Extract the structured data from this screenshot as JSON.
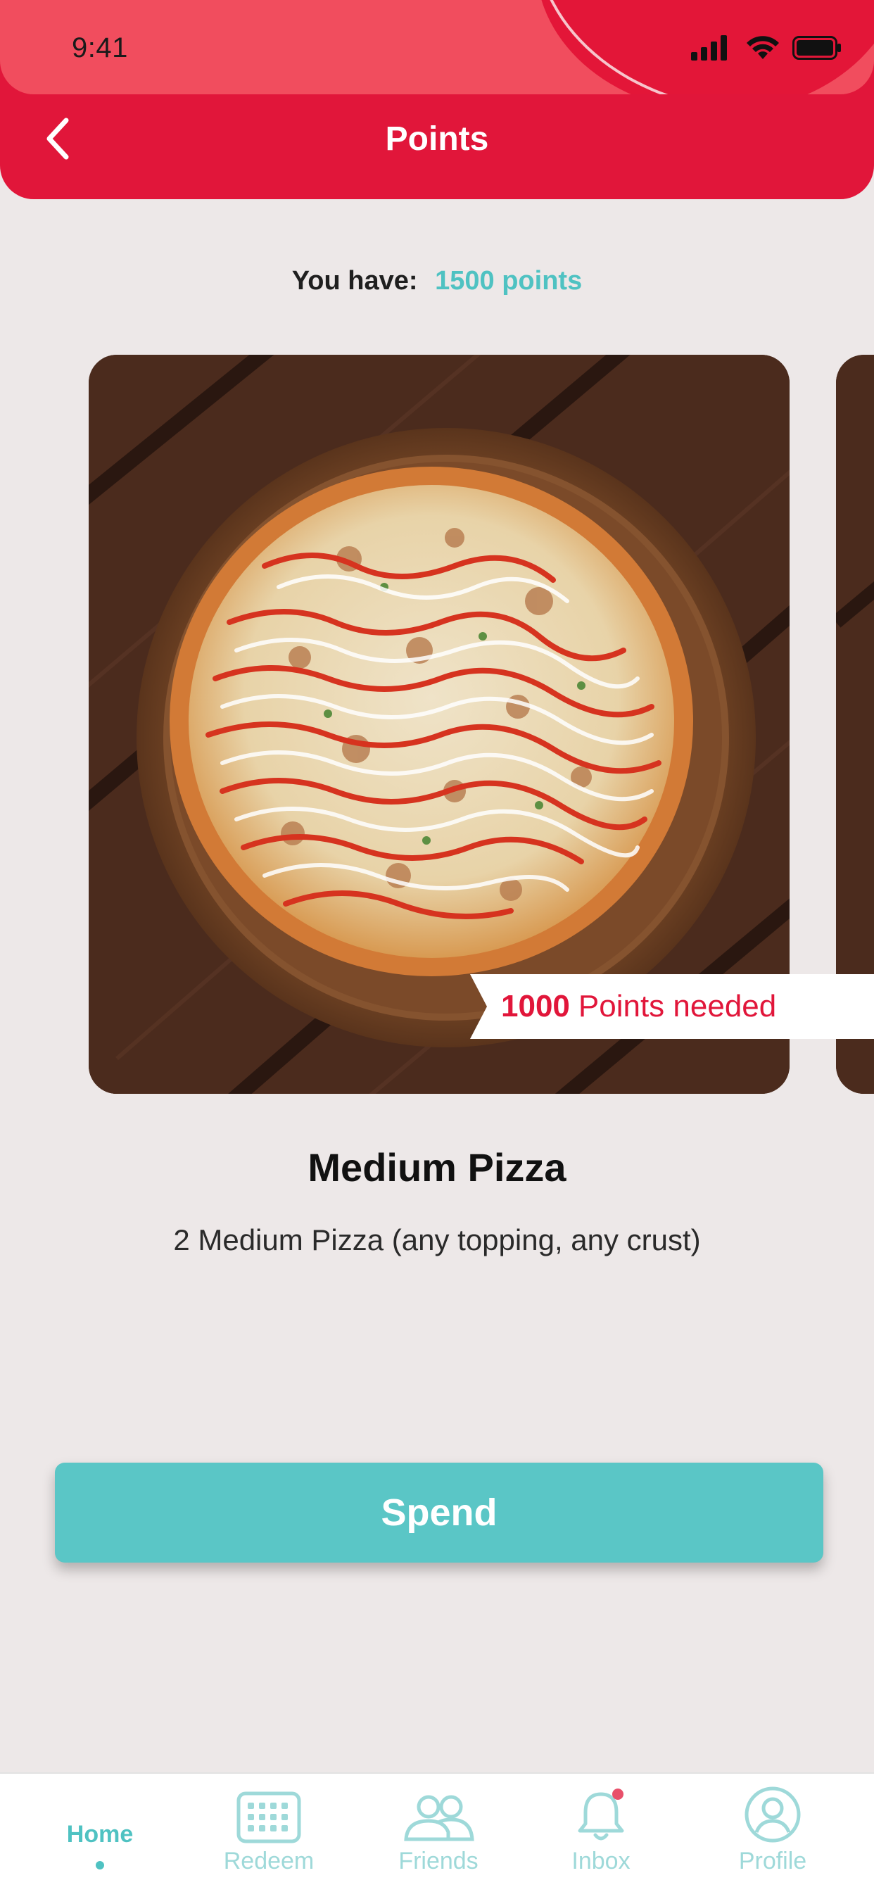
{
  "status_bar": {
    "time": "9:41",
    "icons": [
      "cellular-signal-icon",
      "wifi-icon",
      "battery-icon"
    ]
  },
  "header": {
    "title": "Points",
    "back_icon": "chevron-left-icon"
  },
  "points_summary": {
    "label": "You have:",
    "value": "1500 points"
  },
  "reward": {
    "points_needed_value": "1000",
    "points_needed_label": "Points needed",
    "title": "Medium Pizza",
    "description": "2 Medium Pizza (any topping, any crust)"
  },
  "spend_button": {
    "label": "Spend"
  },
  "bottom_nav": {
    "items": [
      {
        "label": "Home",
        "icon": "",
        "active": true
      },
      {
        "label": "Redeem",
        "icon": "calendar-icon",
        "active": false
      },
      {
        "label": "Friends",
        "icon": "users-icon",
        "active": false
      },
      {
        "label": "Inbox",
        "icon": "bell-icon",
        "active": false,
        "badge": true
      },
      {
        "label": "Profile",
        "icon": "user-circle-icon",
        "active": false
      }
    ]
  },
  "colors": {
    "header": "#e1163a",
    "status_band": "#f14d5e",
    "accent": "#5ac6c6",
    "points_text": "#4fc2c2",
    "background": "#ede8e8",
    "tag_text": "#e1163a"
  }
}
